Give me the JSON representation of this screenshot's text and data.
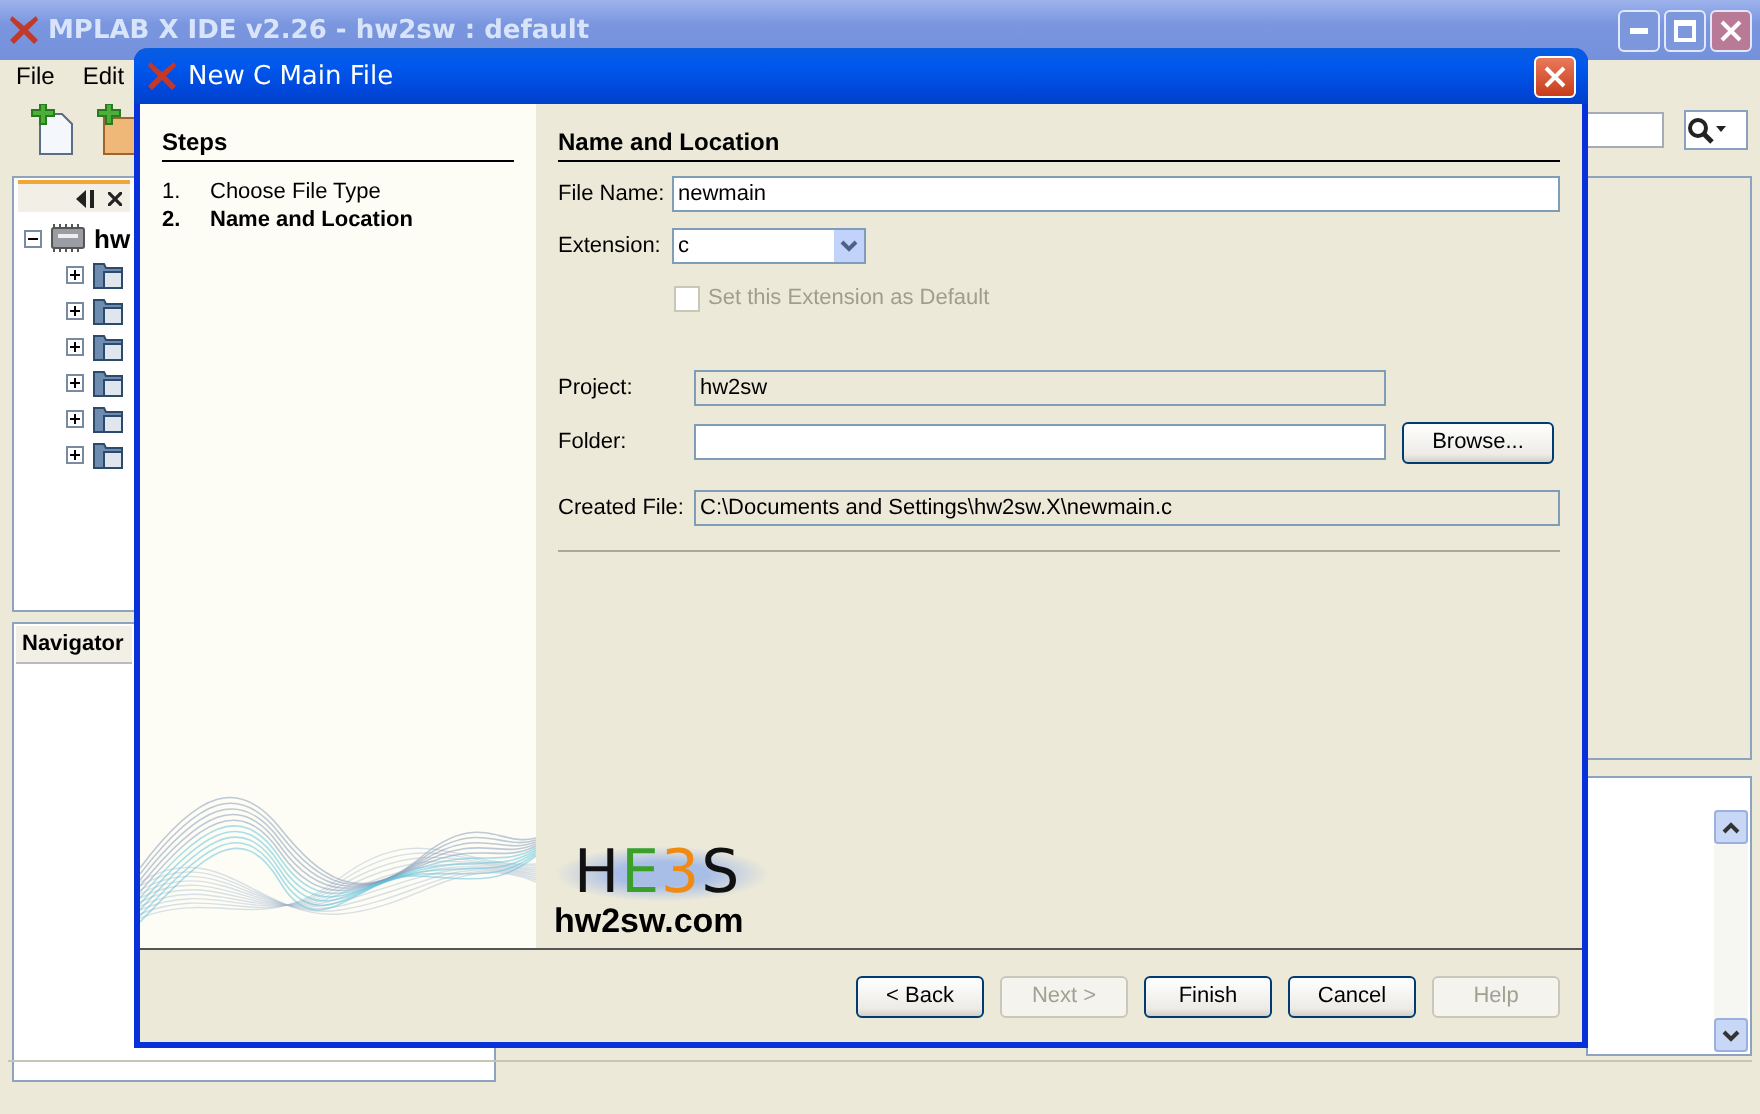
{
  "ide_window": {
    "title": "MPLAB X IDE v2.26 - hw2sw : default",
    "active": false
  },
  "menu_bar": [
    "File",
    "Edit"
  ],
  "projects_panel": {
    "tree": [
      {
        "label": "hw",
        "expanded": true,
        "children": [
          {
            "expanded": false
          },
          {
            "expanded": false
          },
          {
            "expanded": false
          },
          {
            "expanded": false
          },
          {
            "expanded": false
          },
          {
            "expanded": false
          }
        ]
      }
    ]
  },
  "navigator_panel": {
    "title": "Navigator"
  },
  "dialog": {
    "title": "New C Main File",
    "steps_title": "Steps",
    "steps": [
      {
        "number": "1.",
        "label": "Choose File Type",
        "selected": false
      },
      {
        "number": "2.",
        "label": "Name and Location",
        "selected": true
      }
    ],
    "section_title": "Name and Location",
    "file_name": {
      "label": "File Name:",
      "value": "newmain"
    },
    "extension": {
      "label": "Extension:",
      "value": "c"
    },
    "set_default": {
      "label": "Set this Extension as Default",
      "checked": false,
      "disabled": true
    },
    "project": {
      "label": "Project:",
      "value": "hw2sw",
      "editable": false
    },
    "folder": {
      "label": "Folder:",
      "editable": true
    },
    "browse_button": "Browse...",
    "created_file": {
      "label": "Created File:",
      "value": "C:\\Documents and Settings\\hw2sw.X\\newmain.c",
      "editable": false
    },
    "logo": {
      "letters": [
        {
          "text": "H",
          "color": "#111111"
        },
        {
          "text": "E",
          "color": "#3aa02a"
        },
        {
          "text": "3",
          "color": "#f08a10"
        },
        {
          "text": "S",
          "color": "#111111"
        }
      ],
      "caption": "hw2sw.com"
    },
    "buttons": [
      {
        "label": "< Back",
        "disabled": false
      },
      {
        "label": "Next >",
        "disabled": true
      },
      {
        "label": "Finish",
        "disabled": false
      },
      {
        "label": "Cancel",
        "disabled": false
      },
      {
        "label": "Help",
        "disabled": true
      }
    ]
  }
}
